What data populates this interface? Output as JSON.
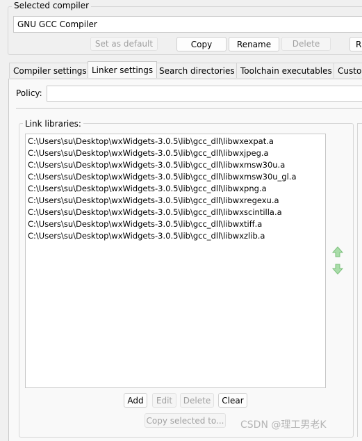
{
  "compiler": {
    "group_label": "Selected compiler",
    "selected_value": "GNU GCC Compiler",
    "buttons": {
      "set_default": "Set as default",
      "copy": "Copy",
      "rename": "Rename",
      "delete": "Delete",
      "reset": "R"
    }
  },
  "tabs": [
    {
      "label": "Compiler settings"
    },
    {
      "label": "Linker settings"
    },
    {
      "label": "Search directories"
    },
    {
      "label": "Toolchain executables"
    },
    {
      "label": "Custor"
    }
  ],
  "policy": {
    "label": "Policy:",
    "value": ""
  },
  "link_libraries": {
    "group_label": "Link libraries:",
    "items": [
      "C:\\Users\\su\\Desktop\\wxWidgets-3.0.5\\lib\\gcc_dll\\libwxexpat.a",
      "C:\\Users\\su\\Desktop\\wxWidgets-3.0.5\\lib\\gcc_dll\\libwxjpeg.a",
      "C:\\Users\\su\\Desktop\\wxWidgets-3.0.5\\lib\\gcc_dll\\libwxmsw30u.a",
      "C:\\Users\\su\\Desktop\\wxWidgets-3.0.5\\lib\\gcc_dll\\libwxmsw30u_gl.a",
      "C:\\Users\\su\\Desktop\\wxWidgets-3.0.5\\lib\\gcc_dll\\libwxpng.a",
      "C:\\Users\\su\\Desktop\\wxWidgets-3.0.5\\lib\\gcc_dll\\libwxregexu.a",
      "C:\\Users\\su\\Desktop\\wxWidgets-3.0.5\\lib\\gcc_dll\\libwxscintilla.a",
      "C:\\Users\\su\\Desktop\\wxWidgets-3.0.5\\lib\\gcc_dll\\libwxtiff.a",
      "C:\\Users\\su\\Desktop\\wxWidgets-3.0.5\\lib\\gcc_dll\\libwxzlib.a"
    ],
    "buttons": {
      "add": "Add",
      "edit": "Edit",
      "delete": "Delete",
      "clear": "Clear",
      "copy_selected": "Copy selected to..."
    }
  },
  "icons": {
    "move_up": "arrow-up-icon",
    "move_down": "arrow-down-icon",
    "accent": "#7cc17c"
  },
  "watermark": "CSDN @理工男老K"
}
